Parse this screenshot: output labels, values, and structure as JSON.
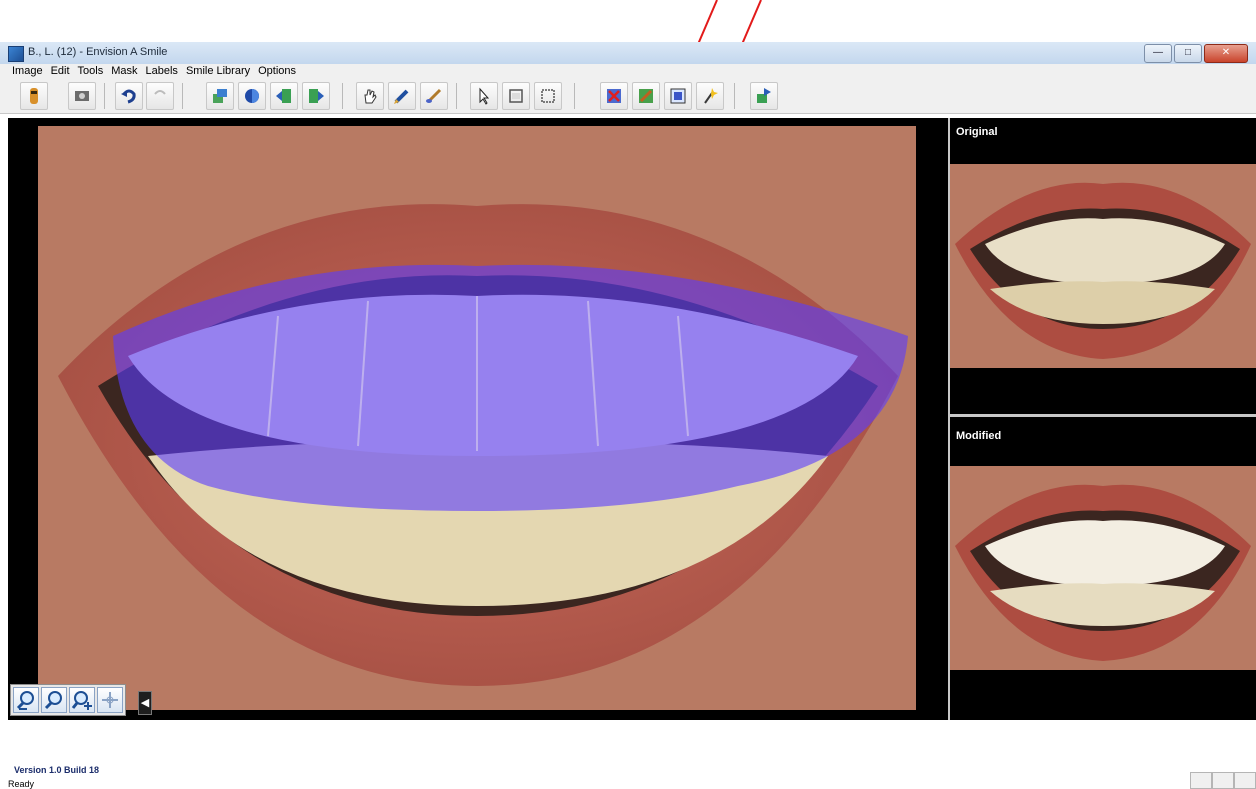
{
  "window": {
    "title": "B., L. (12) - Envision A Smile",
    "min_label": "—",
    "max_label": "□",
    "close_label": "✕"
  },
  "menu": {
    "items": [
      "Image",
      "Edit",
      "Tools",
      "Mask",
      "Labels",
      "Smile Library",
      "Options"
    ]
  },
  "toolbar": {
    "buttons": [
      {
        "icon": "figure-icon"
      },
      {
        "icon": "photo-icon"
      },
      {
        "icon": "undo-icon"
      },
      {
        "icon": "redo-icon"
      },
      {
        "icon": "layer-icon"
      },
      {
        "icon": "color-circle-icon"
      },
      {
        "icon": "move-left-icon"
      },
      {
        "icon": "move-right-icon"
      },
      {
        "icon": "hand-icon"
      },
      {
        "icon": "pen-icon"
      },
      {
        "icon": "brush-icon"
      },
      {
        "icon": "pointer-icon"
      },
      {
        "icon": "frame-icon"
      },
      {
        "icon": "select-box-icon"
      },
      {
        "icon": "delete-mask-icon"
      },
      {
        "icon": "edit-mask-icon"
      },
      {
        "icon": "fill-mask-icon"
      },
      {
        "icon": "wand-icon"
      },
      {
        "icon": "export-icon"
      }
    ]
  },
  "panels": {
    "original_label": "Original",
    "modified_label": "Modified"
  },
  "zoom": {
    "buttons": [
      "zoom-out-icon",
      "zoom-fit-icon",
      "zoom-in-icon",
      "pan-icon"
    ],
    "collapse_label": "◀"
  },
  "status": {
    "version": "Version 1.0 Build 18",
    "text": "Ready"
  },
  "colors": {
    "arrow": "#e21a1a",
    "mask_overlay": "#5a3cff",
    "lips": "#b2483d",
    "teeth": "#e9dfc3"
  }
}
